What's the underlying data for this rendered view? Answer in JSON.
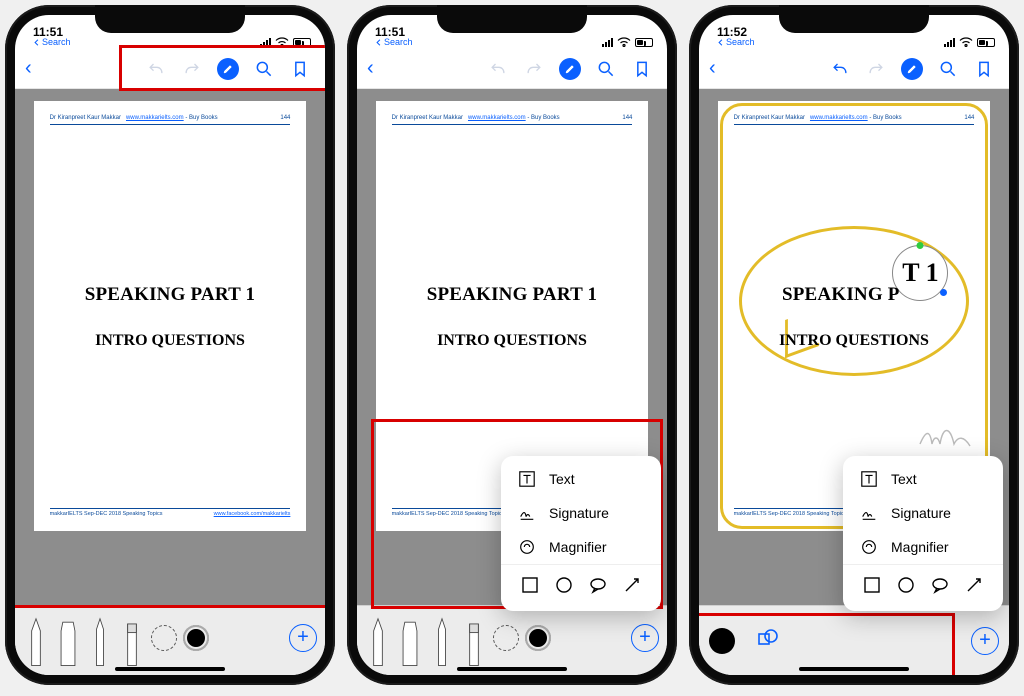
{
  "statusbar": {
    "time1": "11:51",
    "time2": "11:51",
    "time3": "11:52",
    "search_label": "Search"
  },
  "doc": {
    "author": "Dr Kiranpreet Kaur Makkar",
    "site": "www.makkarielts.com",
    "buy": " - Buy Books",
    "page_num": "144",
    "title1": "SPEAKING PART 1",
    "title2": "INTRO QUESTIONS",
    "foot_left": "makkarIELTS Sep-DEC 2018 Speaking Topics",
    "foot_right": "www.facebook.com/makkarielts"
  },
  "popup": {
    "text": "Text",
    "signature": "Signature",
    "magnifier": "Magnifier"
  },
  "mag_text": "T  1"
}
